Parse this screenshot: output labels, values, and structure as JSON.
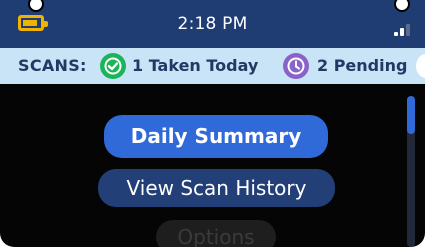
{
  "status_bar": {
    "time": "2:18 PM",
    "battery_icon": "battery-low-icon",
    "signal_icon": "signal-bars-icon",
    "battery_color": "#f0b400",
    "background": "#1f3d73"
  },
  "scans": {
    "label": "SCANS:",
    "taken": {
      "text": "1 Taken Today",
      "icon": "checkmark-icon",
      "color": "#1ab55b"
    },
    "pending": {
      "text": "2 Pending",
      "icon": "clock-icon",
      "color": "#8a63c8"
    },
    "background": "#c9e4f7"
  },
  "menu": {
    "items": [
      {
        "label": "Daily Summary",
        "selected": true,
        "color": "#2f6ad8"
      },
      {
        "label": "View Scan History",
        "selected": false,
        "color": "#233f77"
      },
      {
        "label": "Options",
        "selected": false,
        "faded": true
      }
    ]
  },
  "scrollbar": {
    "accent": "#2f6ad8"
  }
}
